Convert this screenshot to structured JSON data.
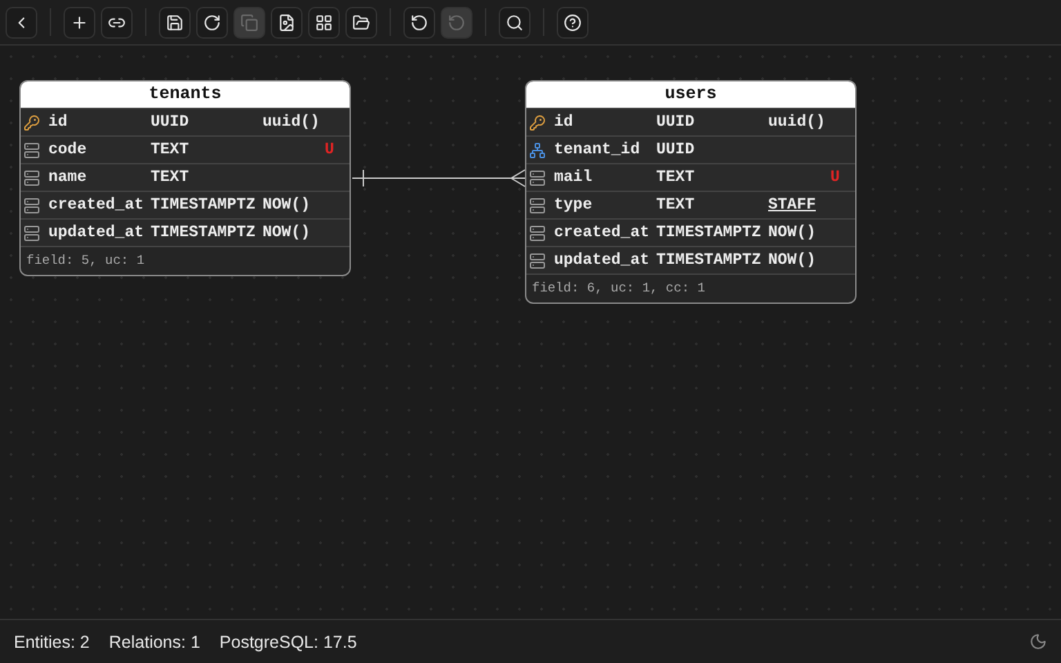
{
  "toolbar": {
    "groups": [
      [
        {
          "disabled": false
        }
      ],
      [
        {
          "disabled": false
        },
        {
          "disabled": false
        }
      ],
      [
        {
          "disabled": false
        },
        {
          "disabled": false
        },
        {
          "disabled": true
        },
        {
          "disabled": false
        },
        {
          "disabled": false
        },
        {
          "disabled": false
        }
      ],
      [
        {
          "disabled": false
        },
        {
          "disabled": true
        }
      ],
      [
        {
          "disabled": false
        }
      ],
      [
        {
          "disabled": false
        }
      ]
    ]
  },
  "entities": [
    {
      "name": "tenants",
      "columns": [
        {
          "kind": "primary",
          "name": "id",
          "type": "UUID",
          "default": "uuid()",
          "enum": false
        },
        {
          "kind": "field",
          "name": "code",
          "type": "TEXT",
          "constraint": "U"
        },
        {
          "kind": "field",
          "name": "name",
          "type": "TEXT"
        },
        {
          "kind": "field",
          "name": "created_at",
          "type": "TIMESTAMPTZ",
          "default": "NOW()",
          "enum": false
        },
        {
          "kind": "field",
          "name": "updated_at",
          "type": "TIMESTAMPTZ",
          "default": "NOW()",
          "enum": false
        }
      ],
      "footer": "field: 5, uc: 1"
    },
    {
      "name": "users",
      "columns": [
        {
          "kind": "primary",
          "name": "id",
          "type": "UUID",
          "default": "uuid()",
          "enum": false
        },
        {
          "kind": "foreign",
          "name": "tenant_id",
          "type": "UUID"
        },
        {
          "kind": "field",
          "name": "mail",
          "type": "TEXT",
          "constraint": "U"
        },
        {
          "kind": "field",
          "name": "type",
          "type": "TEXT",
          "default": "STAFF",
          "enum": true
        },
        {
          "kind": "field",
          "name": "created_at",
          "type": "TIMESTAMPTZ",
          "default": "NOW()",
          "enum": false
        },
        {
          "kind": "field",
          "name": "updated_at",
          "type": "TIMESTAMPTZ",
          "default": "NOW()",
          "enum": false
        }
      ],
      "footer": "field: 6, uc: 1, cc: 1"
    }
  ],
  "status_bar": {
    "items": [
      "Entities: 2",
      "Relations: 1",
      "PostgreSQL: 17.5"
    ]
  }
}
